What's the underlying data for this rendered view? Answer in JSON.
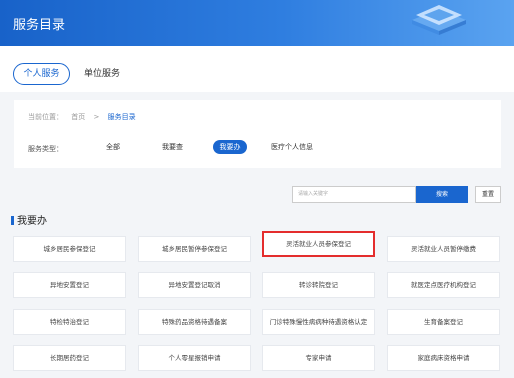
{
  "header": {
    "title": "服务目录"
  },
  "tabs": {
    "personal": "个人服务",
    "unit": "单位服务"
  },
  "breadcrumb": {
    "label": "当前位置：",
    "home": "首页",
    "sep": ">",
    "current": "服务目录"
  },
  "filter": {
    "label": "服务类型：",
    "options": [
      "全部",
      "我要查",
      "我要办",
      "医疗个人信息"
    ],
    "selected": "我要办"
  },
  "search": {
    "placeholder": "请输入关键字",
    "button": "搜索",
    "reset": "重置"
  },
  "section": {
    "title": "我要办"
  },
  "services": [
    "城乡居民参保登记",
    "城乡居民暂停参保登记",
    "灵活就业人员参保登记",
    "灵活就业人员暂停缴费",
    "异地安置登记",
    "异地安置登记取消",
    "转诊转院登记",
    "就医定点医疗机构登记",
    "特检特治登记",
    "特殊药品资格待遇备案",
    "门诊特殊慢性病病种待遇资格认定",
    "生育备案登记",
    "长期居药登记",
    "个人零星报销申请",
    "专家申请",
    "家庭病床资格申请"
  ],
  "highlighted_service": "灵活就业人员参保登记",
  "colors": {
    "primary": "#1a66cf",
    "highlight": "#e42d2d"
  }
}
